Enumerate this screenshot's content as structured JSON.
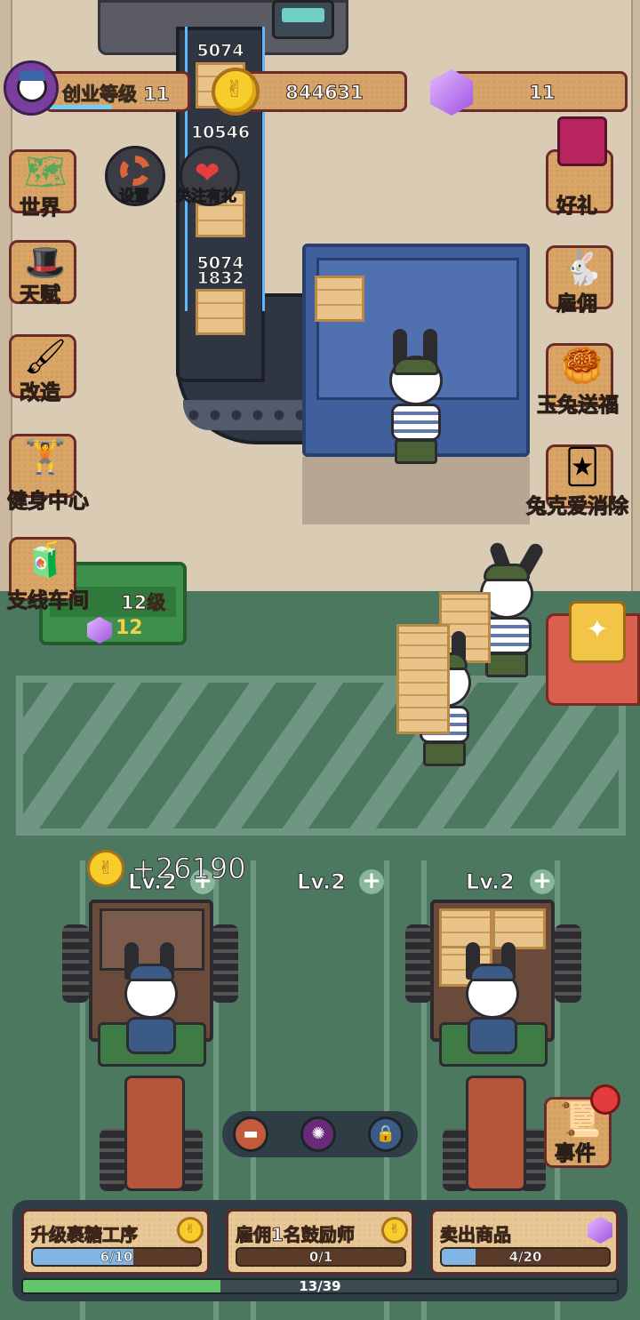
{
  "hud": {
    "level_label": "创业等级 11",
    "coins": "844631",
    "gems": "11"
  },
  "conveyor": {
    "counts": [
      "5074",
      "10546",
      "5074",
      "1832"
    ]
  },
  "left_menu": [
    {
      "label": "世界",
      "icon": "world-map-icon"
    },
    {
      "label": "天赋",
      "icon": "talent-icon"
    },
    {
      "label": "改造",
      "icon": "paint-roller-icon"
    },
    {
      "label": "健身中心",
      "icon": "gym-icon"
    },
    {
      "label": "支线车间",
      "icon": "workshop-icon"
    }
  ],
  "round_buttons": {
    "settings": "设置",
    "follow_gift": "关注有礼"
  },
  "right_menu": [
    {
      "label": "好礼",
      "icon": "gift-box-icon"
    },
    {
      "label": "雇佣",
      "icon": "hire-icon"
    },
    {
      "label": "玉兔送福",
      "icon": "jade-rabbit-icon"
    },
    {
      "label": "兔克爱消除",
      "icon": "cards-icon"
    }
  ],
  "green_sign": {
    "level_text": "12级",
    "gem_cost": "12"
  },
  "trucks": [
    {
      "level": "Lv.2",
      "floating_gain": "+26190"
    },
    {
      "level": "Lv.2"
    },
    {
      "level": "Lv.2"
    }
  ],
  "event_button": {
    "label": "事件"
  },
  "tasks": [
    {
      "title": "升级裹糖工序",
      "progress_text": "6/10",
      "progress": 0.6,
      "reward_icon": "coin-icon"
    },
    {
      "title": "雇佣1名鼓励师",
      "progress_text": "0/1",
      "progress": 0.0,
      "reward_icon": "coin-icon"
    },
    {
      "title": "卖出商品",
      "progress_text": "4/20",
      "progress": 0.2,
      "reward_icon": "gem-icon"
    }
  ],
  "main_progress": {
    "text": "13/39",
    "progress": 0.333
  },
  "colors": {
    "accent_green": "#64c46a",
    "progress_blue": "#7fb6e6",
    "hud_brown": "#d6a46a",
    "yard_green": "#4d7860"
  }
}
